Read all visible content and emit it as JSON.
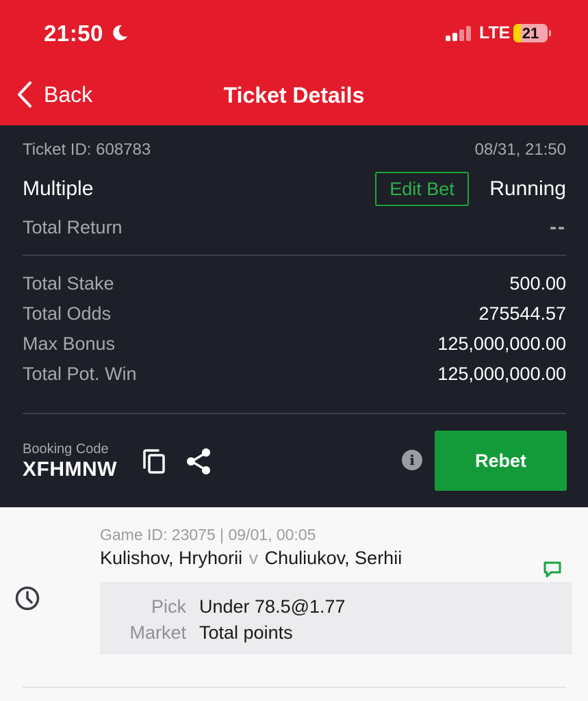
{
  "status_bar": {
    "time": "21:50",
    "network": "LTE",
    "battery": "21",
    "battery_level": 0.21,
    "icons": [
      "moon-icon",
      "signal-icon",
      "battery-icon"
    ]
  },
  "nav": {
    "back_label": "Back",
    "title": "Ticket Details"
  },
  "ticket": {
    "id_label": "Ticket ID: 608783",
    "datetime": "08/31, 21:50",
    "bet_type": "Multiple",
    "edit_label": "Edit Bet",
    "status": "Running",
    "total_return_label": "Total Return",
    "total_return_value": "--",
    "rows": [
      {
        "label": "Total Stake",
        "value": "500.00"
      },
      {
        "label": "Total Odds",
        "value": "275544.57"
      },
      {
        "label": "Max Bonus",
        "value": "125,000,000.00"
      },
      {
        "label": "Total Pot. Win",
        "value": "125,000,000.00"
      }
    ],
    "booking_code_label": "Booking Code",
    "booking_code": "XFHMNW",
    "rebet_label": "Rebet"
  },
  "selection": {
    "game_meta": "Game ID: 23075 | 09/01, 00:05",
    "home": "Kulishov, Hryhorii",
    "vs": "v",
    "away": "Chuliukov, Serhii",
    "pick_label": "Pick",
    "pick_value": "Under 78.5@1.77",
    "market_label": "Market",
    "market_value": "Total points"
  },
  "colors": {
    "header_red": "#e41b2a",
    "panel_dark": "#1d2028",
    "accent_green": "#139b3a"
  }
}
